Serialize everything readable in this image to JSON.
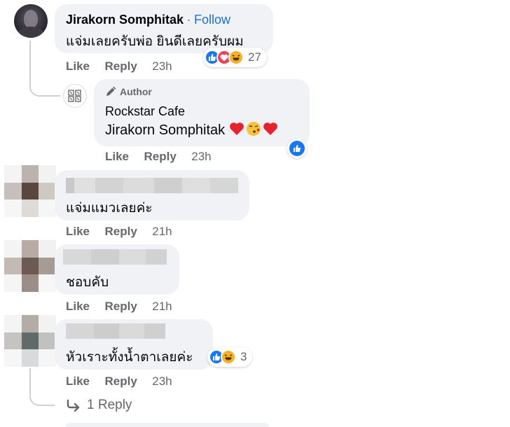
{
  "comments": [
    {
      "author": "Jirakorn Somphitak",
      "follow_label": "Follow",
      "separator": "·",
      "text": "แจ่มเลยครับพ่อ ยินดีเลยครับผม",
      "reactions_count": "27",
      "like_label": "Like",
      "reply_label": "Reply",
      "time": "23h"
    },
    {
      "author_badge": "Author",
      "author": "Rockstar Cafe",
      "mention": "Jirakorn Somphitak",
      "like_label": "Like",
      "reply_label": "Reply",
      "time": "23h"
    },
    {
      "text": "แจ่มแมวเลยค่ะ",
      "like_label": "Like",
      "reply_label": "Reply",
      "time": "21h"
    },
    {
      "text": "ชอบคับ",
      "like_label": "Like",
      "reply_label": "Reply",
      "time": "21h"
    },
    {
      "text": "หัวเราะทั้งน้ำตาเลยค่ะ",
      "reactions_count": "3",
      "like_label": "Like",
      "reply_label": "Reply",
      "time": "23h"
    }
  ],
  "replies_link": "1 Reply",
  "icons": {
    "like": "like-reaction-icon",
    "love": "love-reaction-icon",
    "haha": "haha-reaction-icon",
    "pencil": "pencil-icon",
    "reply_arrow": "reply-arrow-icon"
  },
  "colors": {
    "link_blue": "#216fdb",
    "bubble_bg": "#f0f2f5",
    "meta_gray": "#65676b",
    "like_blue": "#1877f2",
    "love_red": "#f33e58",
    "haha_yellow": "#f7b125"
  }
}
